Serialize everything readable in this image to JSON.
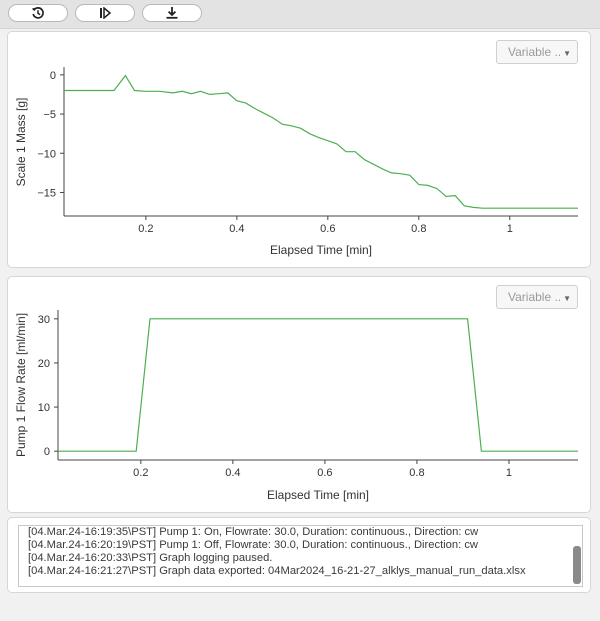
{
  "toolbar": {
    "buttons": [
      {
        "icon": "history-icon"
      },
      {
        "icon": "step-forward-icon"
      },
      {
        "icon": "download-icon"
      }
    ]
  },
  "colors": {
    "line": "#4caf50",
    "axis": "#444444"
  },
  "charts": [
    {
      "variable_select": "Variable ..",
      "chart_data": {
        "type": "line",
        "xlabel": "Elapsed Time [min]",
        "ylabel": "Scale 1 Mass [g]",
        "xlim": [
          0.02,
          1.15
        ],
        "ylim": [
          -18,
          1
        ],
        "xticks": [
          0.2,
          0.4,
          0.6,
          0.8,
          1
        ],
        "xtick_labels": [
          "0.2",
          "0.4",
          "0.6",
          "0.8",
          "1"
        ],
        "yticks": [
          0,
          -5,
          -10,
          -15
        ],
        "ytick_labels": [
          "0",
          "−5",
          "−10",
          "−15"
        ],
        "x": [
          0.02,
          0.1,
          0.13,
          0.155,
          0.175,
          0.2,
          0.23,
          0.26,
          0.28,
          0.3,
          0.32,
          0.34,
          0.36,
          0.38,
          0.4,
          0.42,
          0.44,
          0.46,
          0.48,
          0.5,
          0.52,
          0.54,
          0.56,
          0.58,
          0.6,
          0.62,
          0.64,
          0.66,
          0.68,
          0.7,
          0.72,
          0.74,
          0.76,
          0.78,
          0.8,
          0.82,
          0.84,
          0.86,
          0.88,
          0.9,
          0.92,
          0.94,
          0.96,
          1.0,
          1.15
        ],
        "y": [
          -2,
          -2,
          -2,
          -0.1,
          -2,
          -2.1,
          -2.1,
          -2.3,
          -2.1,
          -2.4,
          -2.1,
          -2.5,
          -2.4,
          -2.3,
          -3.3,
          -3.6,
          -4.3,
          -4.9,
          -5.5,
          -6.3,
          -6.5,
          -6.8,
          -7.5,
          -8.0,
          -8.4,
          -8.8,
          -9.8,
          -9.8,
          -10.8,
          -11.4,
          -12.0,
          -12.5,
          -12.6,
          -12.8,
          -14.0,
          -14.1,
          -14.5,
          -15.5,
          -15.4,
          -16.7,
          -16.9,
          -17.0,
          -17.0,
          -17.0,
          -17.0
        ]
      }
    },
    {
      "variable_select": "Variable ..",
      "chart_data": {
        "type": "line",
        "xlabel": "Elapsed Time [min]",
        "ylabel": "Pump 1 Flow Rate [ml/min]",
        "xlim": [
          0.02,
          1.15
        ],
        "ylim": [
          -2,
          32
        ],
        "xticks": [
          0.2,
          0.4,
          0.6,
          0.8,
          1
        ],
        "xtick_labels": [
          "0.2",
          "0.4",
          "0.6",
          "0.8",
          "1"
        ],
        "yticks": [
          0,
          10,
          20,
          30
        ],
        "ytick_labels": [
          "0",
          "10",
          "20",
          "30"
        ],
        "x": [
          0.02,
          0.19,
          0.22,
          0.91,
          0.94,
          1.15
        ],
        "y": [
          0,
          0,
          30,
          30,
          0,
          0
        ]
      }
    }
  ],
  "log": {
    "lines": [
      "[04.Mar.24-16:19:35\\PST] Pump 1: On, Flowrate: 30.0, Duration: continuous., Direction: cw",
      "[04.Mar.24-16:20:19\\PST] Pump 1: Off, Flowrate: 30.0, Duration: continuous., Direction: cw",
      "[04.Mar.24-16:20:33\\PST] Graph logging paused.",
      "[04.Mar.24-16:21:27\\PST] Graph data exported: 04Mar2024_16-21-27_alklys_manual_run_data.xlsx"
    ]
  }
}
